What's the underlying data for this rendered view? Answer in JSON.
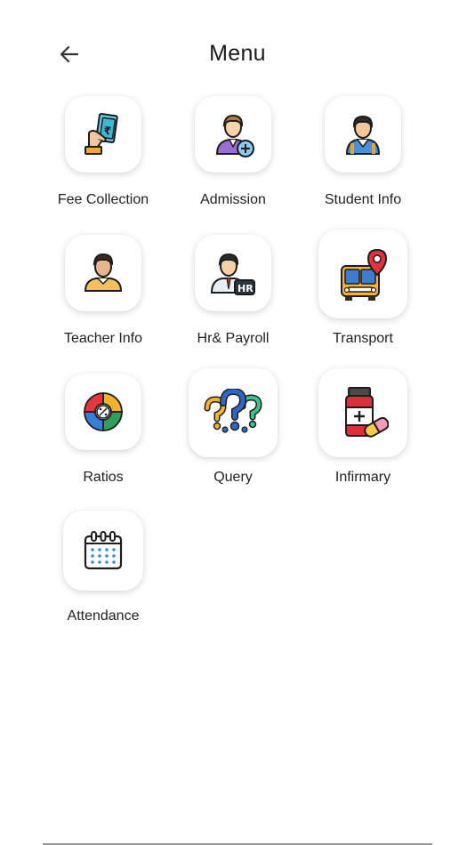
{
  "header": {
    "title": "Menu"
  },
  "menu": {
    "items": [
      {
        "label": "Fee Collection",
        "icon": "fee-collection-icon"
      },
      {
        "label": "Admission",
        "icon": "admission-icon"
      },
      {
        "label": "Student Info",
        "icon": "student-info-icon"
      },
      {
        "label": "Teacher Info",
        "icon": "teacher-info-icon"
      },
      {
        "label": "Hr& Payroll",
        "icon": "hr-payroll-icon"
      },
      {
        "label": "Transport",
        "icon": "transport-bus-icon"
      },
      {
        "label": "Ratios",
        "icon": "ratios-chart-icon"
      },
      {
        "label": "Query",
        "icon": "query-question-icon"
      },
      {
        "label": "Infirmary",
        "icon": "infirmary-medicine-icon"
      },
      {
        "label": "Attendance",
        "icon": "attendance-calendar-icon"
      }
    ]
  }
}
